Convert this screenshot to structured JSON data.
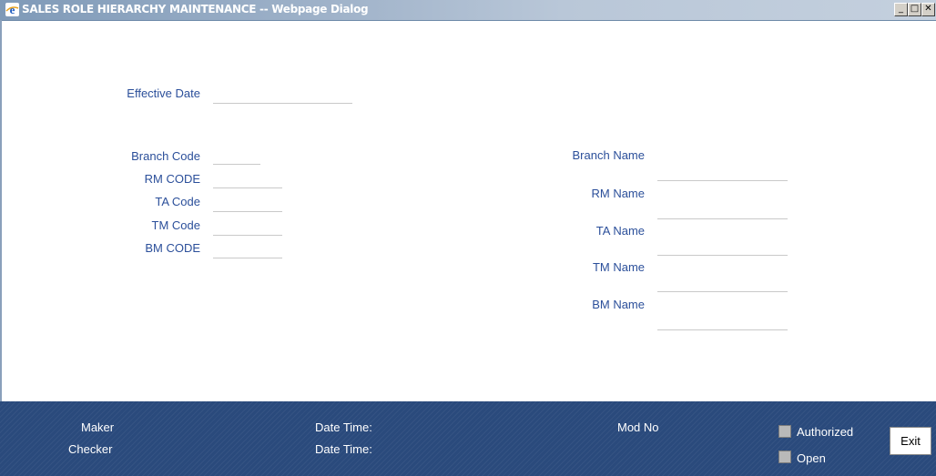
{
  "window": {
    "title": "SALES ROLE HIERARCHY MAINTENANCE -- Webpage Dialog",
    "icon": "ie-icon",
    "minimize_glyph": "_",
    "maximize_glyph": "□",
    "close_glyph": "✕"
  },
  "form": {
    "effective_date": {
      "label": "Effective Date",
      "value": ""
    },
    "branch_code": {
      "label": "Branch Code",
      "value": ""
    },
    "rm_code": {
      "label": "RM CODE",
      "value": ""
    },
    "ta_code": {
      "label": "TA Code",
      "value": ""
    },
    "tm_code": {
      "label": "TM Code",
      "value": ""
    },
    "bm_code": {
      "label": "BM CODE",
      "value": ""
    },
    "branch_name": {
      "label": "Branch Name",
      "value": ""
    },
    "rm_name": {
      "label": "RM Name",
      "value": ""
    },
    "ta_name": {
      "label": "TA Name",
      "value": ""
    },
    "tm_name": {
      "label": "TM Name",
      "value": ""
    },
    "bm_name": {
      "label": "BM Name",
      "value": ""
    }
  },
  "footer": {
    "maker_label": "Maker",
    "checker_label": "Checker",
    "date_time_label_1": "Date Time:",
    "date_time_label_2": "Date Time:",
    "mod_no_label": "Mod No",
    "authorized_label": "Authorized",
    "open_label": "Open",
    "exit_label": "Exit"
  },
  "colors": {
    "label_text": "#2b4f9a",
    "footer_bg": "#2a4a7c",
    "titlebar": "#9fb2c9"
  }
}
